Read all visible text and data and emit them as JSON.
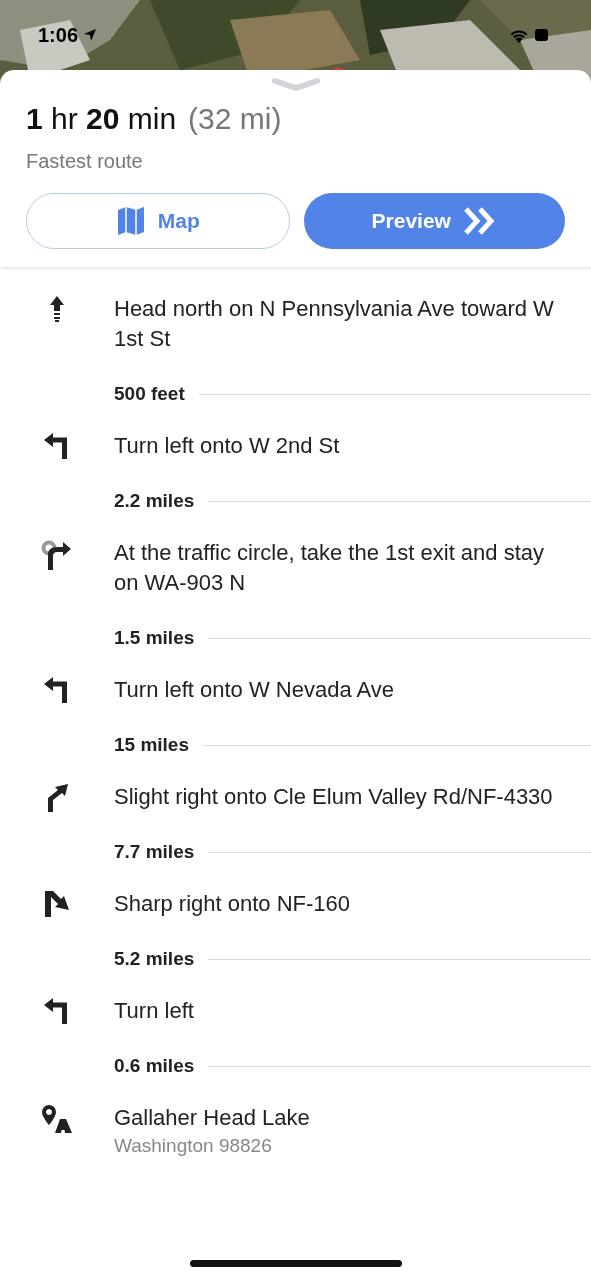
{
  "status_bar": {
    "time": "1:06"
  },
  "route": {
    "duration": "**1** hr **20** min",
    "distance": "(32 mi)",
    "subtitle": "Fastest route"
  },
  "buttons": [
    {
      "kind": "map",
      "label": "Map"
    },
    {
      "kind": "preview",
      "label": "Preview"
    }
  ],
  "steps": [
    {
      "kind": "straight",
      "instruction": "Head north on N Pennsylvania Ave toward W 1st St",
      "distance": "500 feet"
    },
    {
      "kind": "left",
      "instruction": "Turn left onto W 2nd St",
      "distance": "2.2 miles"
    },
    {
      "kind": "roundabout",
      "instruction": "At the traffic circle, take the 1st exit and stay on WA-903 N",
      "distance": "1.5 miles"
    },
    {
      "kind": "left",
      "instruction": "Turn left onto W Nevada Ave",
      "distance": "15 miles"
    },
    {
      "kind": "slight-right",
      "instruction": "Slight right onto Cle Elum Valley Rd/NF-4330",
      "distance": "7.7 miles"
    },
    {
      "kind": "sharp-right",
      "instruction": "Sharp right onto NF-160",
      "distance": "5.2 miles"
    },
    {
      "kind": "left",
      "instruction": "Turn left",
      "distance": "0.6 miles"
    },
    {
      "kind": "destination",
      "instruction": "Gallaher Head Lake",
      "subtitle": "Washington 98826"
    }
  ]
}
